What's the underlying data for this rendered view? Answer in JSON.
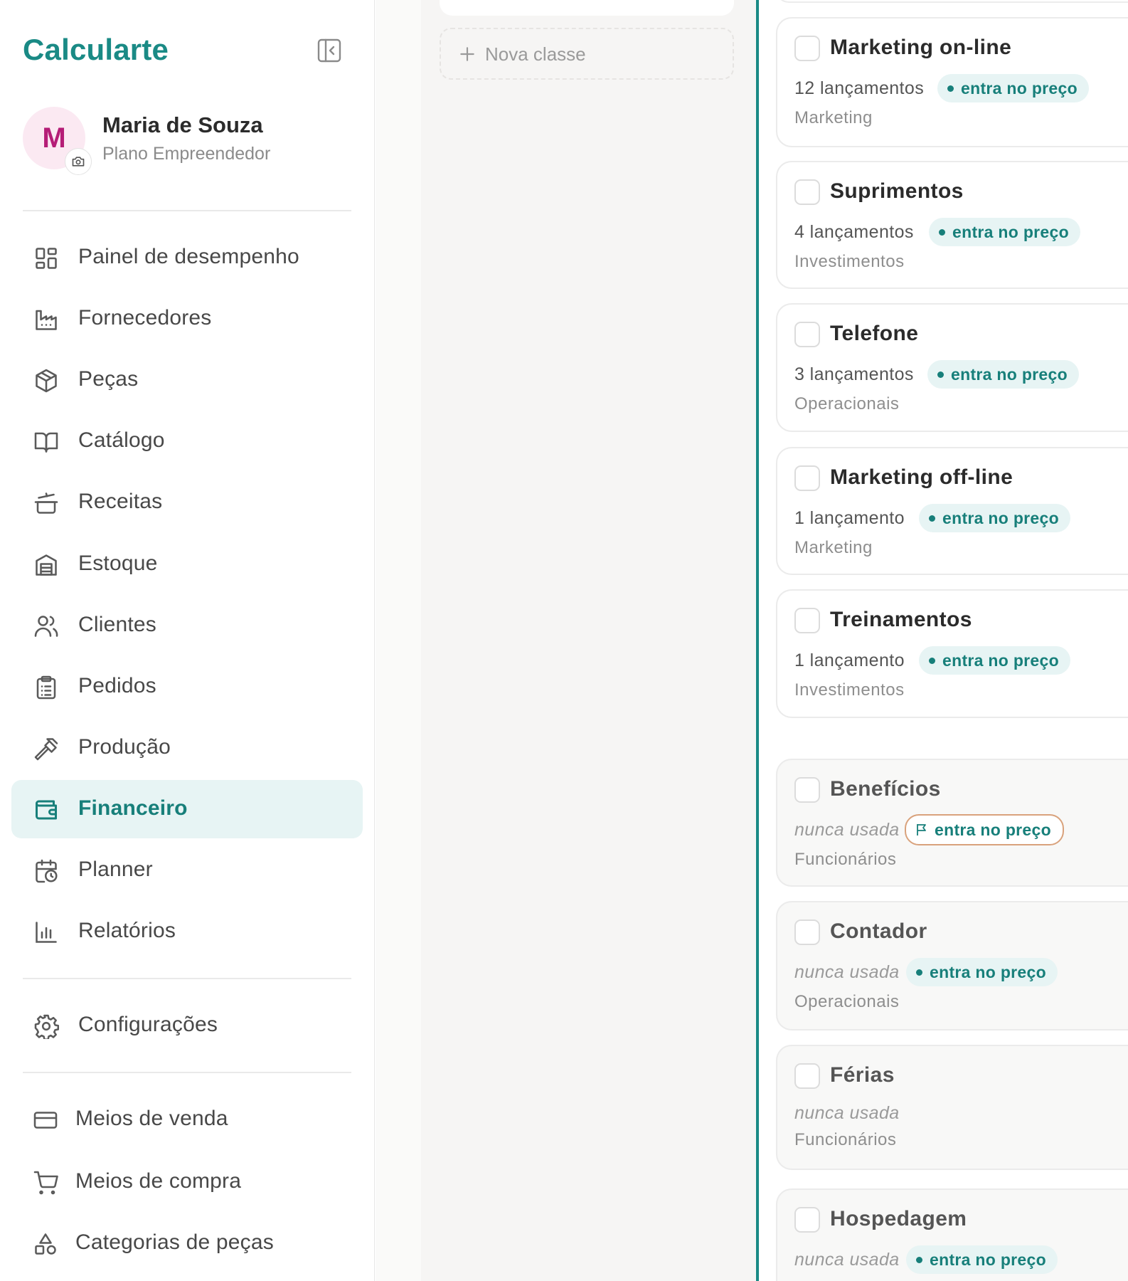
{
  "app": {
    "name": "Calcularte"
  },
  "user": {
    "initial": "M",
    "name": "Maria de Souza",
    "plan": "Plano Empreendedor"
  },
  "nav": {
    "main": [
      {
        "id": "painel",
        "label": "Painel de desempenho",
        "icon": "dashboard-icon"
      },
      {
        "id": "fornecedores",
        "label": "Fornecedores",
        "icon": "factory-icon"
      },
      {
        "id": "pecas",
        "label": "Peças",
        "icon": "box-icon"
      },
      {
        "id": "catalogo",
        "label": "Catálogo",
        "icon": "book-open-icon"
      },
      {
        "id": "receitas",
        "label": "Receitas",
        "icon": "pot-icon"
      },
      {
        "id": "estoque",
        "label": "Estoque",
        "icon": "warehouse-icon"
      },
      {
        "id": "clientes",
        "label": "Clientes",
        "icon": "users-icon"
      },
      {
        "id": "pedidos",
        "label": "Pedidos",
        "icon": "clipboard-list-icon"
      },
      {
        "id": "producao",
        "label": "Produção",
        "icon": "hammer-icon"
      },
      {
        "id": "financeiro",
        "label": "Financeiro",
        "icon": "wallet-icon",
        "active": true
      },
      {
        "id": "planner",
        "label": "Planner",
        "icon": "calendar-clock-icon"
      },
      {
        "id": "relatorios",
        "label": "Relatórios",
        "icon": "bar-chart-icon"
      }
    ],
    "settings": {
      "label": "Configurações",
      "icon": "gear-icon"
    },
    "secondary": [
      {
        "id": "meios-venda",
        "label": "Meios de venda",
        "icon": "credit-card-icon"
      },
      {
        "id": "meios-compra",
        "label": "Meios de compra",
        "icon": "cart-icon"
      },
      {
        "id": "categorias-pecas",
        "label": "Categorias de peças",
        "icon": "shapes-icon"
      }
    ]
  },
  "middle": {
    "new_class_label": "Nova classe"
  },
  "cards": [
    {
      "title": "Marketing on-line",
      "count": "12 lançamentos",
      "badge": "entra no preço",
      "category": "Marketing"
    },
    {
      "title": "Suprimentos",
      "count": "4 lançamentos",
      "badge": "entra no preço",
      "category": "Investimentos"
    },
    {
      "title": "Telefone",
      "count": "3 lançamentos",
      "badge": "entra no preço",
      "category": "Operacionais"
    },
    {
      "title": "Marketing off-line",
      "count": "1 lançamento",
      "badge": "entra no preço",
      "category": "Marketing"
    },
    {
      "title": "Treinamentos",
      "count": "1 lançamento",
      "badge": "entra no preço",
      "category": "Investimentos"
    },
    {
      "title": "Benefícios",
      "count": "nunca usada",
      "badge": "entra no preço",
      "category": "Funcionários"
    },
    {
      "title": "Contador",
      "count": "nunca usada",
      "badge": "entra no preço",
      "category": "Operacionais"
    },
    {
      "title": "Férias",
      "count": "nunca usada",
      "badge": "",
      "category": "Funcionários"
    },
    {
      "title": "Hospedagem",
      "count": "nunca usada",
      "badge": "entra no preço",
      "category": ""
    }
  ],
  "colors": {
    "brand": "#1a8a85",
    "active_bg": "#e7f4f4",
    "avatar_bg": "#fbe9f2",
    "avatar_fg": "#b51d77",
    "flag_border": "#d9a27c"
  }
}
